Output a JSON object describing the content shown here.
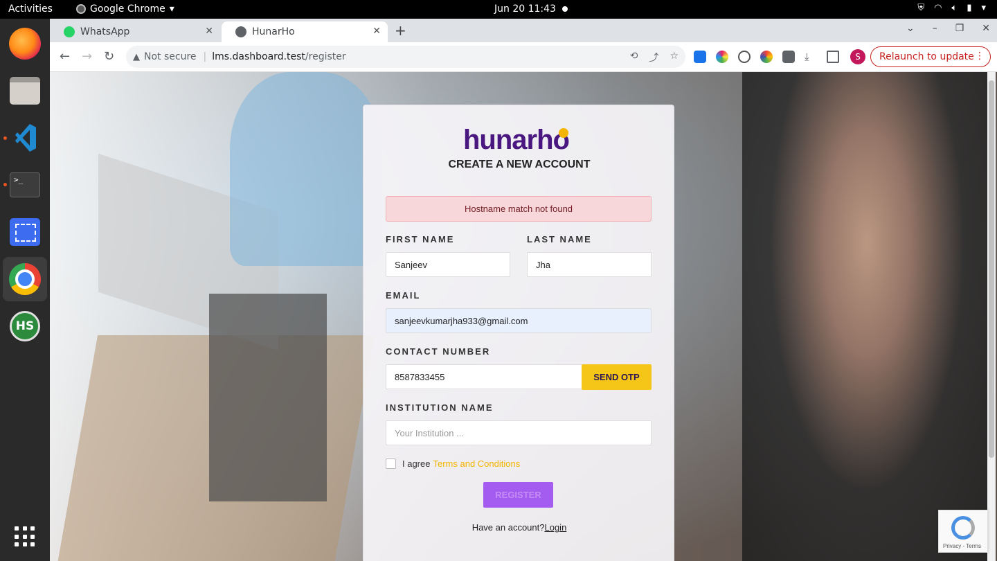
{
  "topbar": {
    "activities": "Activities",
    "app_name": "Google Chrome",
    "clock": "Jun 20  11:43"
  },
  "dock": {
    "items": [
      "firefox-icon",
      "files-icon",
      "vscode-icon",
      "terminal-icon",
      "screenshot-icon",
      "chrome-icon",
      "hs-icon",
      "show-apps-icon"
    ],
    "terminal_glyph": ">_",
    "hs_label": "HS"
  },
  "browser": {
    "tabs": [
      {
        "label": "WhatsApp",
        "icon": "whatsapp-icon",
        "active": false
      },
      {
        "label": "HunarHo",
        "icon": "globe-icon",
        "active": true
      }
    ],
    "omnibox": {
      "security": "Not secure",
      "host": "lms.dashboard.test",
      "path": "/register"
    },
    "profile_initial": "S",
    "relaunch_label": "Relaunch to update"
  },
  "form": {
    "logo_text": "hunarho",
    "title": "CREATE A NEW ACCOUNT",
    "alert": "Hostname match not found",
    "first_name": {
      "label": "FIRST NAME",
      "value": "Sanjeev"
    },
    "last_name": {
      "label": "LAST NAME",
      "value": "Jha"
    },
    "email": {
      "label": "EMAIL",
      "value": "sanjeevkumarjha933@gmail.com"
    },
    "contact": {
      "label": "CONTACT NUMBER",
      "value": "8587833455",
      "otp_button": "SEND OTP"
    },
    "institution": {
      "label": "INSTITUTION NAME",
      "placeholder": "Your Institution ..."
    },
    "agree_text": "I agree",
    "terms_link": "Terms and Conditions",
    "register_button": "REGISTER",
    "have_account": "Have an account?",
    "login_link": "Login"
  },
  "recaptcha": {
    "footer": "Privacy - Terms"
  },
  "colors": {
    "brand_purple": "#4a1781",
    "accent_yellow": "#f5c518",
    "register_purple": "#a45cf0",
    "alert_bg": "#f8d7da",
    "relaunch_red": "#c5221f"
  }
}
